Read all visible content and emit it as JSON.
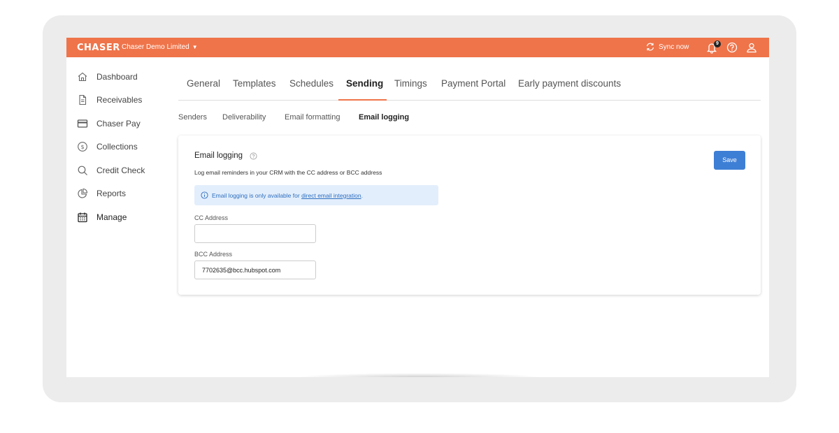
{
  "colors": {
    "brand": "#ef744a",
    "primary_button": "#3e7fd6",
    "info_bg": "#e3eefc",
    "info_text": "#2e6fbf"
  },
  "topbar": {
    "logo": "CHASER",
    "org_name": "Chaser Demo Limited",
    "sync_label": "Sync now",
    "notification_count": "9"
  },
  "sidebar": {
    "items": [
      {
        "label": "Dashboard",
        "icon": "home-icon"
      },
      {
        "label": "Receivables",
        "icon": "document-icon"
      },
      {
        "label": "Chaser Pay",
        "icon": "credit-card-icon"
      },
      {
        "label": "Collections",
        "icon": "dollar-circle-icon"
      },
      {
        "label": "Credit Check",
        "icon": "search-icon"
      },
      {
        "label": "Reports",
        "icon": "pie-chart-icon"
      },
      {
        "label": "Manage",
        "icon": "calendar-icon"
      }
    ],
    "active": "Manage"
  },
  "tabs": {
    "items": [
      "General",
      "Templates",
      "Schedules",
      "Sending",
      "Timings",
      "Payment Portal",
      "Early payment discounts"
    ],
    "active": "Sending"
  },
  "subtabs": {
    "items": [
      "Senders",
      "Deliverability",
      "Email formatting",
      "Email logging"
    ],
    "active": "Email logging"
  },
  "card": {
    "title": "Email logging",
    "description": "Log email reminders in your CRM with the CC address or BCC address",
    "info_text": "Email logging is only available for",
    "info_link": "direct email integration",
    "info_suffix": ".",
    "save_label": "Save",
    "cc_label": "CC Address",
    "cc_value": "",
    "bcc_label": "BCC Address",
    "bcc_value": "7702635@bcc.hubspot.com"
  }
}
